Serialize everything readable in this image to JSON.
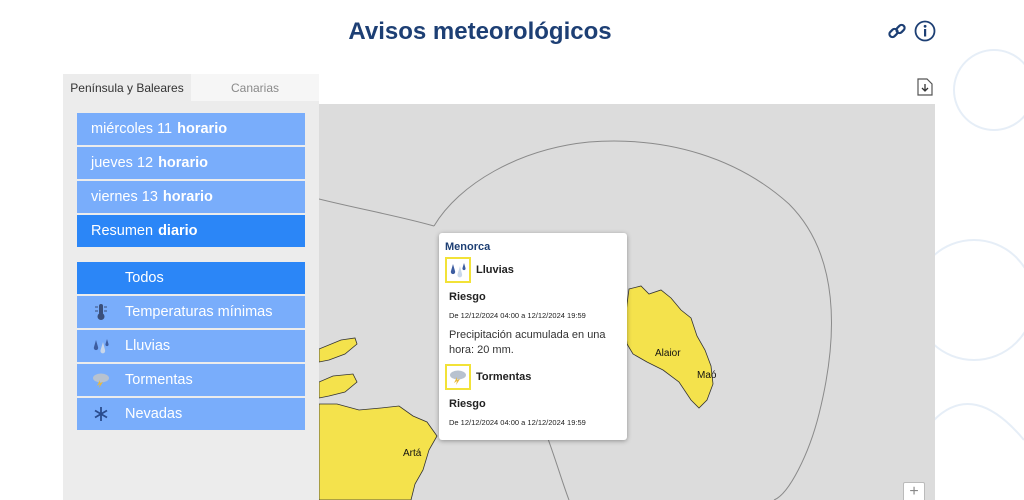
{
  "title": "Avisos meteorológicos",
  "icons": {
    "link": "link-icon",
    "info": "info-icon",
    "download": "download-icon"
  },
  "tabs": [
    {
      "label": "Península y Baleares",
      "active": true
    },
    {
      "label": "Canarias",
      "active": false
    }
  ],
  "days": [
    {
      "day": "miércoles 11",
      "mode": "horario"
    },
    {
      "day": "jueves 12",
      "mode": "horario"
    },
    {
      "day": "viernes 13",
      "mode": "horario"
    },
    {
      "day": "Resumen",
      "mode": "diario",
      "active": true
    }
  ],
  "types": [
    {
      "label": "Todos",
      "icon": "",
      "active": true
    },
    {
      "label": "Temperaturas mínimas",
      "icon": "thermometer-icon"
    },
    {
      "label": "Lluvias",
      "icon": "rain-icon"
    },
    {
      "label": "Tormentas",
      "icon": "storm-icon"
    },
    {
      "label": "Nevadas",
      "icon": "snowflake-icon"
    }
  ],
  "map": {
    "places": [
      "Alaior",
      "Maó",
      "Artá"
    ],
    "zoom_in_label": "+"
  },
  "popup": {
    "region": "Menorca",
    "alerts": [
      {
        "name": "Lluvias",
        "icon": "rain-icon",
        "risk": "Riesgo",
        "period": "De 12/12/2024 04:00 a 12/12/2024 19:59",
        "description": "Precipitación acumulada en una hora: 20 mm."
      },
      {
        "name": "Tormentas",
        "icon": "storm-icon",
        "risk": "Riesgo",
        "period": "De 12/12/2024 04:00 a 12/12/2024 19:59"
      }
    ]
  },
  "colors": {
    "title": "#1d3f74",
    "menu_item": "#79adfb",
    "menu_active": "#2b86f7",
    "warning_yellow": "#f4e24c",
    "map_bg": "#dcdcdc"
  }
}
